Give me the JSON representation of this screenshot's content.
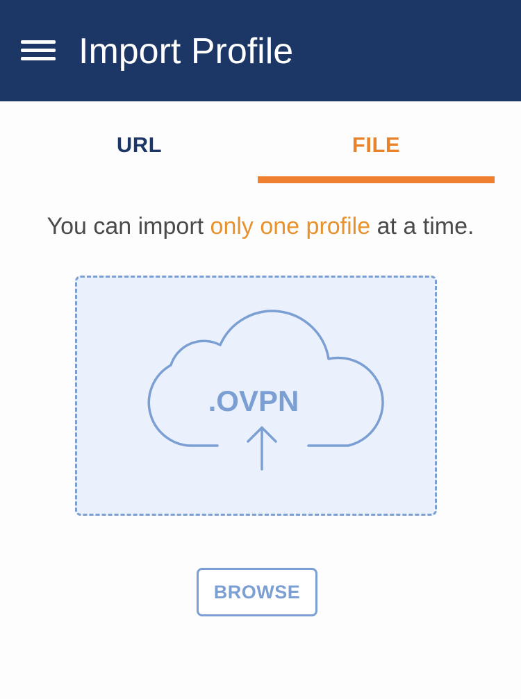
{
  "header": {
    "title": "Import Profile",
    "menu_icon": "hamburger-menu-icon",
    "background": "#1c3766"
  },
  "tabs": [
    {
      "label": "URL",
      "selected": false
    },
    {
      "label": "FILE",
      "selected": true
    }
  ],
  "info": {
    "prefix": "You can import ",
    "highlight": "only one profile",
    "suffix": " at a time."
  },
  "dropzone": {
    "icon": "cloud-upload-icon",
    "file_type_label": ".OVPN"
  },
  "browse_button": {
    "label": "BROWSE"
  },
  "colors": {
    "accent": "#ee8030",
    "primary": "#1c3766",
    "dropzone_stroke": "#7b9fd3",
    "dropzone_fill": "#eaf1fc"
  }
}
